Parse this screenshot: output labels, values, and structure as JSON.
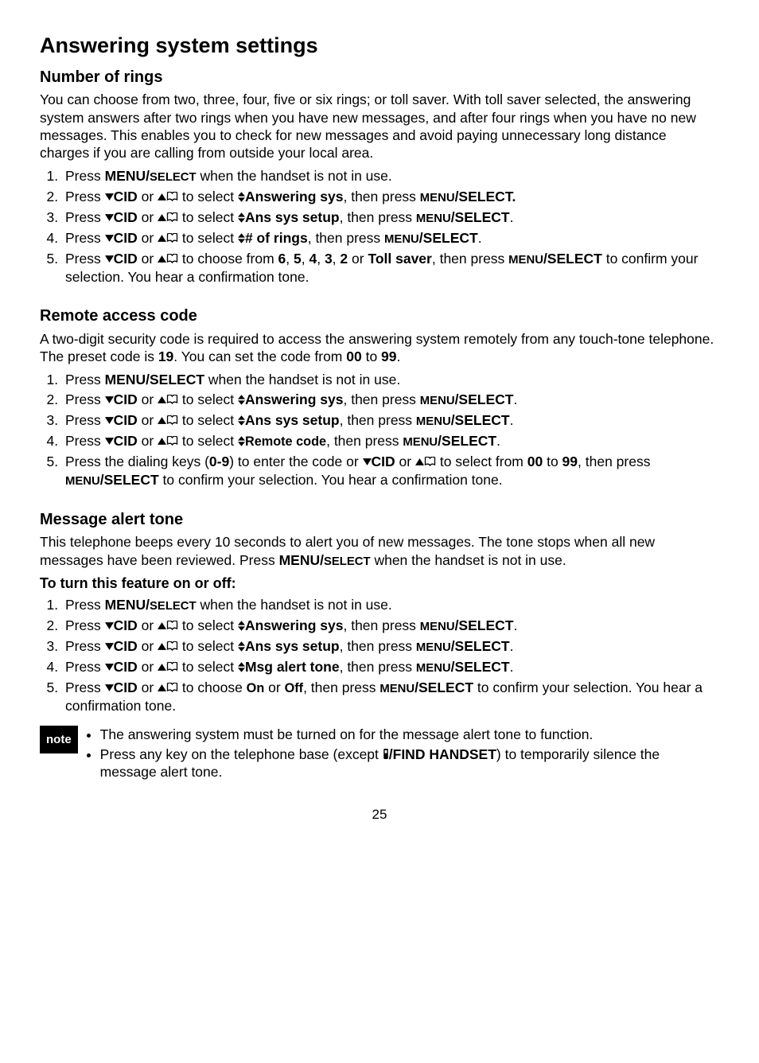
{
  "page": {
    "title": "Answering system settings",
    "number": "25"
  },
  "note_label": "note",
  "icons": {
    "down": "▼",
    "up": "▲",
    "cid": "CID",
    "phonebook": "phonebook-icon",
    "handset": "handset-icon",
    "updown": "updown-icon"
  },
  "sections": [
    {
      "heading": "Number of rings",
      "intro": "You can choose from two, three, four, five or six rings; or toll saver. With toll saver selected, the answering system answers after two rings when you have new messages, and after four rings when you have no new messages. This enables you to check for new messages and avoid paying unnecessary long distance charges if you are calling from outside your local area.",
      "steps": [
        {
          "pre": "Press ",
          "key1": "MENU/",
          "smallkey": "SELECT",
          "post": " when the handset is not in use."
        },
        {
          "select_text": "Answering sys",
          "press": "MENU",
          "press2": "/SELECT."
        },
        {
          "select_text": "Ans sys setup",
          "press": "MENU",
          "press2": "/SELECT"
        },
        {
          "select_text": "# of rings",
          "press": "MENU",
          "press2": "/SELECT"
        },
        {
          "choose_from": [
            "6",
            "5",
            "4",
            "3",
            "2",
            "Toll saver"
          ],
          "press": "MENU",
          "press2": "/SELECT",
          "tail": " to confirm your selection. You hear a confirmation tone."
        }
      ]
    },
    {
      "heading": "Remote access code",
      "intro_parts": {
        "a": "A two-digit security code is required to access the answering system remotely from any touch-tone telephone. The preset code is ",
        "code1": "19",
        "b": ". You can set the code from ",
        "code2": "00",
        "c": " to ",
        "code3": "99",
        "d": "."
      },
      "steps": [
        {
          "pre": "Press ",
          "key1": "MENU/SELECT",
          "post": " when the handset is not in use."
        },
        {
          "select_text": "Answering sys",
          "press": "MENU",
          "press2": "/SELECT"
        },
        {
          "select_text": "Ans sys setup",
          "press": "MENU",
          "press2": "/SELECT"
        },
        {
          "select_text": "Remote code",
          "smaller": true,
          "press": "MENU",
          "press2": "/SELECT"
        },
        {
          "dial": "Press the dialing keys (",
          "range": "0-9",
          "dial2": ") to enter the code or ",
          "select_from": "00",
          "to": "99",
          "press": "MENU",
          "press2": "/SELECT",
          "tail": " to confirm your selection. You hear a confirmation tone."
        }
      ]
    },
    {
      "heading": "Message alert tone",
      "intro_parts": {
        "a": "This telephone beeps every 10 seconds to alert you of new messages. The tone stops when all new messages have been reviewed. Press ",
        "key": "MENU/",
        "smallkey": "SELECT",
        "b": " when the handset is not in use."
      },
      "subheading": "To turn this feature on or off:",
      "steps": [
        {
          "pre": "Press ",
          "key1": "MENU/",
          "smallkey": "SELECT",
          "post": " when the handset is not in use."
        },
        {
          "select_text": "Answering sys",
          "press": "MENU",
          "press2": "/SELECT"
        },
        {
          "select_text": "Ans sys setup",
          "press": "MENU",
          "press2": "/SELECT"
        },
        {
          "select_text": "Msg alert tone",
          "press": "MENU",
          "press2": "/SELECT"
        },
        {
          "choose_two": [
            "On",
            "Off"
          ],
          "press": "MENU",
          "press2": "/SELECT",
          "tail": " to confirm your selection. You hear a confirmation tone."
        }
      ],
      "notes": [
        "The answering system must be turned on for the message alert tone to function.",
        {
          "a": "Press any key on the telephone base (except ",
          "key": "/FIND HANDSET",
          "b": ") to temporarily silence the message alert tone."
        }
      ]
    }
  ]
}
